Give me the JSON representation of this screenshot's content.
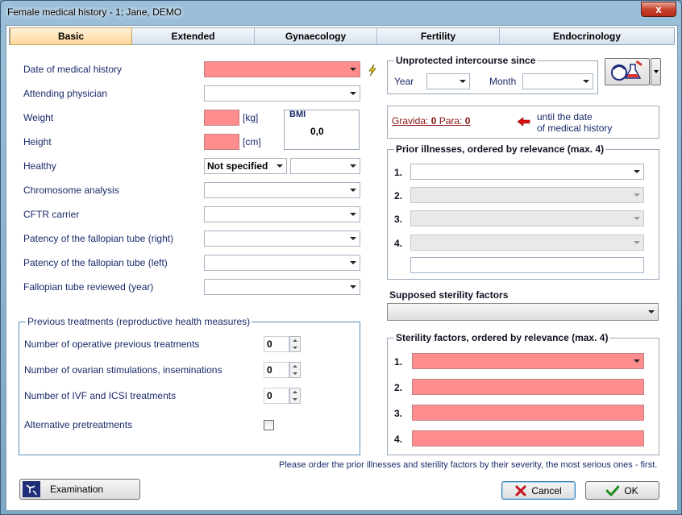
{
  "window": {
    "title": "Female medical history - 1; Jane, DEMO",
    "close_label": "x"
  },
  "tabs": [
    "Basic",
    "Extended",
    "Gynaecology",
    "Fertility",
    "Endocrinology"
  ],
  "fields": {
    "date_of_history": "Date of medical history",
    "attending_physician": "Attending physician",
    "weight": "Weight",
    "weight_unit": "[kg]",
    "height": "Height",
    "height_unit": "[cm]",
    "healthy": "Healthy",
    "healthy_value": "Not specified",
    "chromosome": "Chromosome analysis",
    "cftr": "CFTR carrier",
    "patency_right": "Patency of the fallopian tube (right)",
    "patency_left": "Patency of the fallopian tube (left)",
    "tube_reviewed": "Fallopian tube reviewed (year)"
  },
  "bmi": {
    "label": "BMI",
    "value": "0,0"
  },
  "intercourse": {
    "title": "Unprotected intercourse since",
    "year_label": "Year",
    "month_label": "Month"
  },
  "gravida": {
    "gravida_label": "Gravida: ",
    "gravida_value": "0",
    "para_label": " Para: ",
    "para_value": "0",
    "until_line1": "until the date",
    "until_line2": "of medical history"
  },
  "prior_illnesses": {
    "title": "Prior illnesses, ordered by relevance (max. 4)",
    "numbers": [
      "1.",
      "2.",
      "3.",
      "4."
    ]
  },
  "supposed_factors": {
    "title": "Supposed sterility factors"
  },
  "sterility_factors": {
    "title": "Sterility factors, ordered by relevance (max. 4)",
    "numbers": [
      "1.",
      "2.",
      "3.",
      "4."
    ]
  },
  "previous_treatments": {
    "title": "Previous treatments (reproductive health measures)",
    "operative": {
      "label": "Number of operative previous treatments",
      "value": "0"
    },
    "ovarian": {
      "label": "Number of ovarian stimulations, inseminations",
      "value": "0"
    },
    "ivf": {
      "label": "Number of IVF and ICSI treatments",
      "value": "0"
    },
    "alternative": "Alternative pretreatments"
  },
  "note": "Please order the prior illnesses and sterility factors by their severity, the most serious ones - first.",
  "buttons": {
    "examination": "Examination",
    "cancel": "Cancel",
    "ok": "OK"
  },
  "colors": {
    "required": "#ff8d8d",
    "accent": "#1a2a6a"
  }
}
